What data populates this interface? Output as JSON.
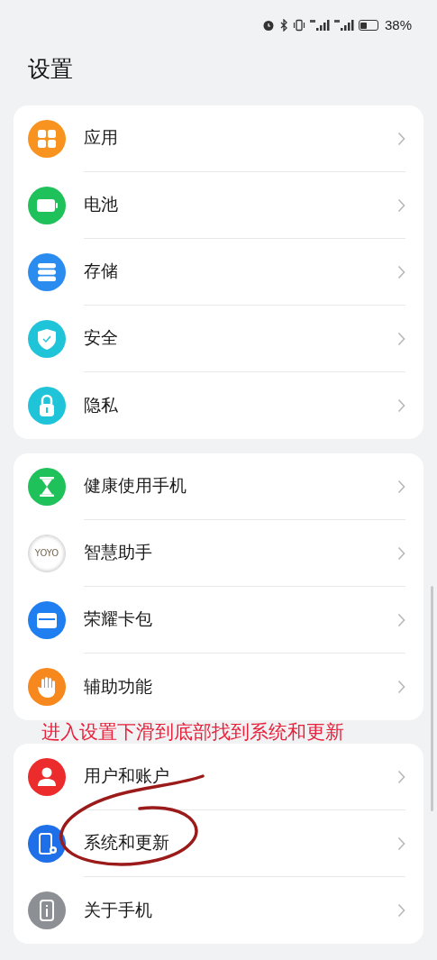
{
  "status_bar": {
    "battery": "38%"
  },
  "title": "设置",
  "groups": [
    {
      "items": [
        {
          "label": "应用",
          "kind": "apps"
        },
        {
          "label": "电池",
          "kind": "battery"
        },
        {
          "label": "存储",
          "kind": "storage"
        },
        {
          "label": "安全",
          "kind": "shield"
        },
        {
          "label": "隐私",
          "kind": "lock"
        }
      ]
    },
    {
      "items": [
        {
          "label": "健康使用手机",
          "kind": "hourglass"
        },
        {
          "label": "智慧助手",
          "kind": "yoyo",
          "icon_text": "YOYO"
        },
        {
          "label": "荣耀卡包",
          "kind": "wallet"
        },
        {
          "label": "辅助功能",
          "kind": "hand"
        }
      ]
    },
    {
      "items": [
        {
          "label": "用户和账户",
          "kind": "user"
        },
        {
          "label": "系统和更新",
          "kind": "phone-gear",
          "circled": true
        },
        {
          "label": "关于手机",
          "kind": "info"
        }
      ]
    }
  ],
  "annotation": "进入设置下滑到底部找到系统和更新"
}
